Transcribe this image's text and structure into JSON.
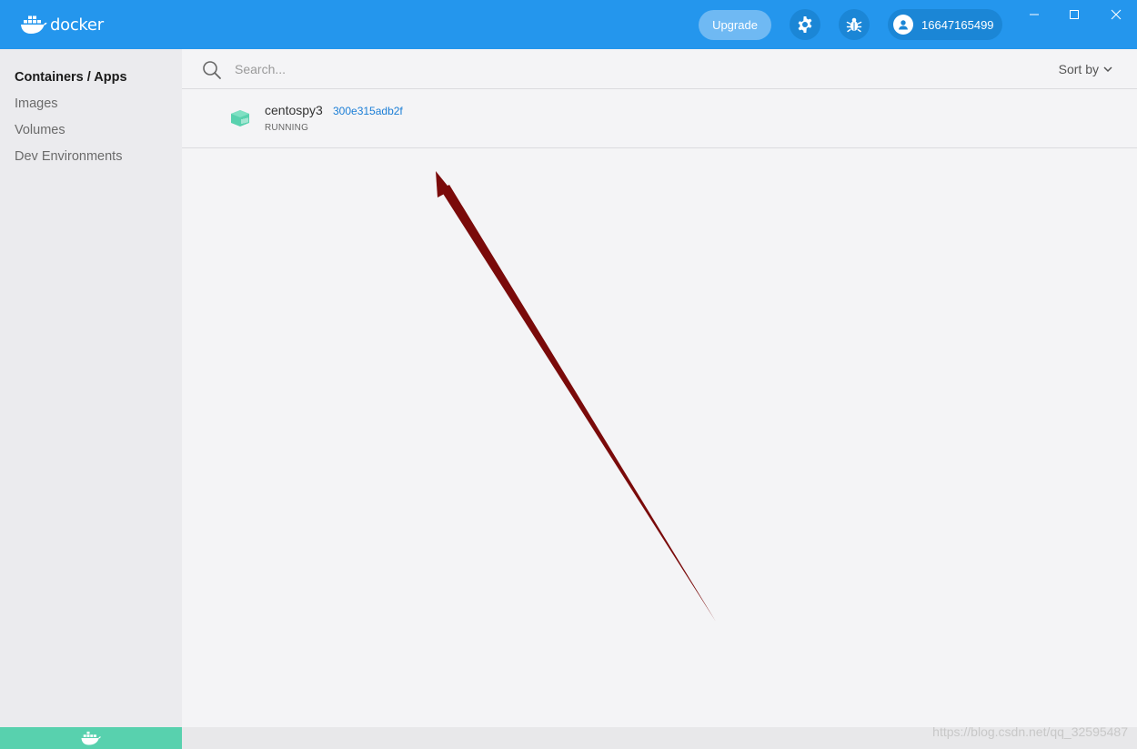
{
  "header": {
    "brand": "docker",
    "upgrade_label": "Upgrade",
    "account_id": "16647165499"
  },
  "sidebar": {
    "items": [
      {
        "label": "Containers / Apps",
        "active": true
      },
      {
        "label": "Images",
        "active": false
      },
      {
        "label": "Volumes",
        "active": false
      },
      {
        "label": "Dev Environments",
        "active": false
      }
    ]
  },
  "search": {
    "placeholder": "Search...",
    "value": ""
  },
  "sort": {
    "label": "Sort by"
  },
  "containers": [
    {
      "name": "centospy3",
      "id": "300e315adb2f",
      "status": "RUNNING"
    }
  ],
  "watermark": "https://blog.csdn.net/qq_32595487",
  "colors": {
    "accent": "#2496ed",
    "running": "#58d1ae",
    "annotation_arrow": "#7a0a0a"
  },
  "icons": [
    "docker-logo-icon",
    "gear-icon",
    "bug-icon",
    "user-icon",
    "minimize-icon",
    "maximize-icon",
    "close-icon",
    "search-icon",
    "chevron-down-icon",
    "container-icon",
    "whale-icon"
  ]
}
